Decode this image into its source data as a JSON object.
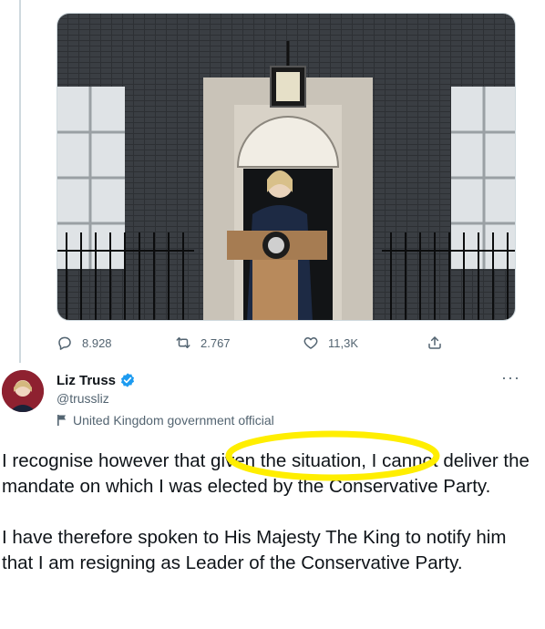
{
  "media": {
    "icon": "tweet-photo"
  },
  "actions": {
    "replies": "8.928",
    "retweets": "2.767",
    "likes": "11,3K"
  },
  "author": {
    "name": "Liz Truss",
    "handle": "@trussliz",
    "label": "United Kingdom government official",
    "verified": true
  },
  "more_icon": "more-icon",
  "tweet": {
    "paragraph1": "I recognise however that given the situation, I cannot deliver the mandate on which I was elected by the Conservative Party.",
    "paragraph2": "I have therefore spoken to His Majesty The King to notify him that I am resigning as Leader of the Conservative Party."
  },
  "colors": {
    "verified": "#1d9bf0",
    "highlight": "#ffee00",
    "secondary_text": "#536471"
  }
}
